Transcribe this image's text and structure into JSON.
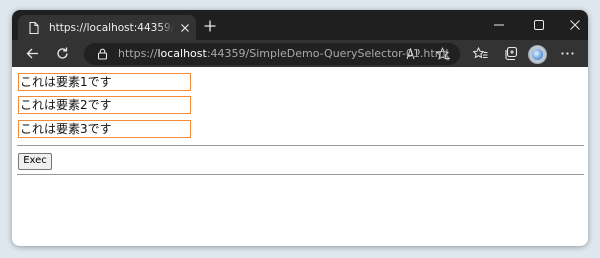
{
  "browser": {
    "tab_title": "https://localhost:44359/SimpleDemo-QuerySelector-01.html",
    "url_scheme": "https://",
    "url_host": "localhost",
    "url_rest": ":44359/SimpleDemo-QuerySelector-01.html"
  },
  "page": {
    "elements": [
      "これは要素1です",
      "これは要素2です",
      "これは要素3です"
    ],
    "exec_label": "Exec"
  },
  "colors": {
    "tab_strip": "#1f1f1f",
    "toolbar": "#333333",
    "element_border": "#f28a38"
  }
}
